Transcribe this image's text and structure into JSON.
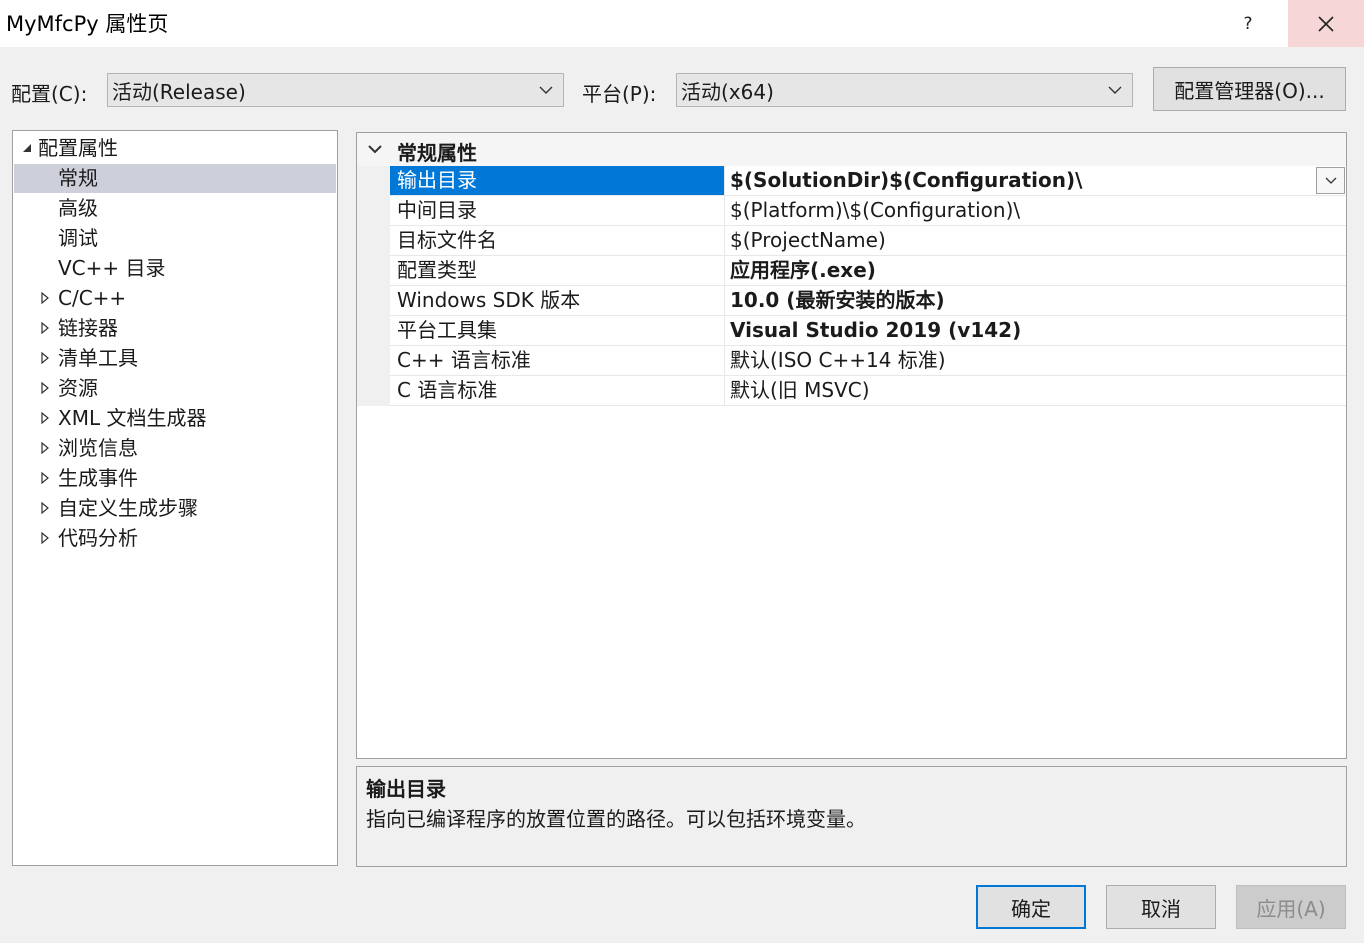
{
  "window": {
    "title": "MyMfcPy 属性页",
    "help_label": "?",
    "close_icon": "close-icon"
  },
  "config": {
    "config_label": "配置(C):",
    "config_value": "活动(Release)",
    "platform_label": "平台(P):",
    "platform_value": "活动(x64)",
    "manager_label": "配置管理器(O)..."
  },
  "tree": {
    "root_label": "配置属性",
    "items": [
      {
        "label": "常规",
        "expandable": false,
        "selected": true
      },
      {
        "label": "高级",
        "expandable": false
      },
      {
        "label": "调试",
        "expandable": false
      },
      {
        "label": "VC++ 目录",
        "expandable": false
      },
      {
        "label": "C/C++",
        "expandable": true
      },
      {
        "label": "链接器",
        "expandable": true
      },
      {
        "label": "清单工具",
        "expandable": true
      },
      {
        "label": "资源",
        "expandable": true
      },
      {
        "label": "XML 文档生成器",
        "expandable": true
      },
      {
        "label": "浏览信息",
        "expandable": true
      },
      {
        "label": "生成事件",
        "expandable": true
      },
      {
        "label": "自定义生成步骤",
        "expandable": true
      },
      {
        "label": "代码分析",
        "expandable": true
      }
    ]
  },
  "grid": {
    "category": "常规属性",
    "rows": [
      {
        "name": "输出目录",
        "value": "$(SolutionDir)$(Configuration)\\",
        "bold": true,
        "selected": true
      },
      {
        "name": "中间目录",
        "value": "$(Platform)\\$(Configuration)\\",
        "bold": false
      },
      {
        "name": "目标文件名",
        "value": "$(ProjectName)",
        "bold": false
      },
      {
        "name": "配置类型",
        "value": "应用程序(.exe)",
        "bold": true
      },
      {
        "name": "Windows SDK 版本",
        "value": "10.0 (最新安装的版本)",
        "bold": true
      },
      {
        "name": "平台工具集",
        "value": "Visual Studio 2019 (v142)",
        "bold": true
      },
      {
        "name": "C++ 语言标准",
        "value": "默认(ISO C++14 标准)",
        "bold": false
      },
      {
        "name": "C 语言标准",
        "value": "默认(旧 MSVC)",
        "bold": false
      }
    ]
  },
  "description": {
    "title": "输出目录",
    "text": "指向已编译程序的放置位置的路径。可以包括环境变量。"
  },
  "buttons": {
    "ok": "确定",
    "cancel": "取消",
    "apply": "应用(A)"
  },
  "colors": {
    "selection": "#0078d7",
    "tree_selection": "#cdd0da",
    "ok_border": "#0078d7",
    "disabled_text": "#8c8c8c"
  }
}
